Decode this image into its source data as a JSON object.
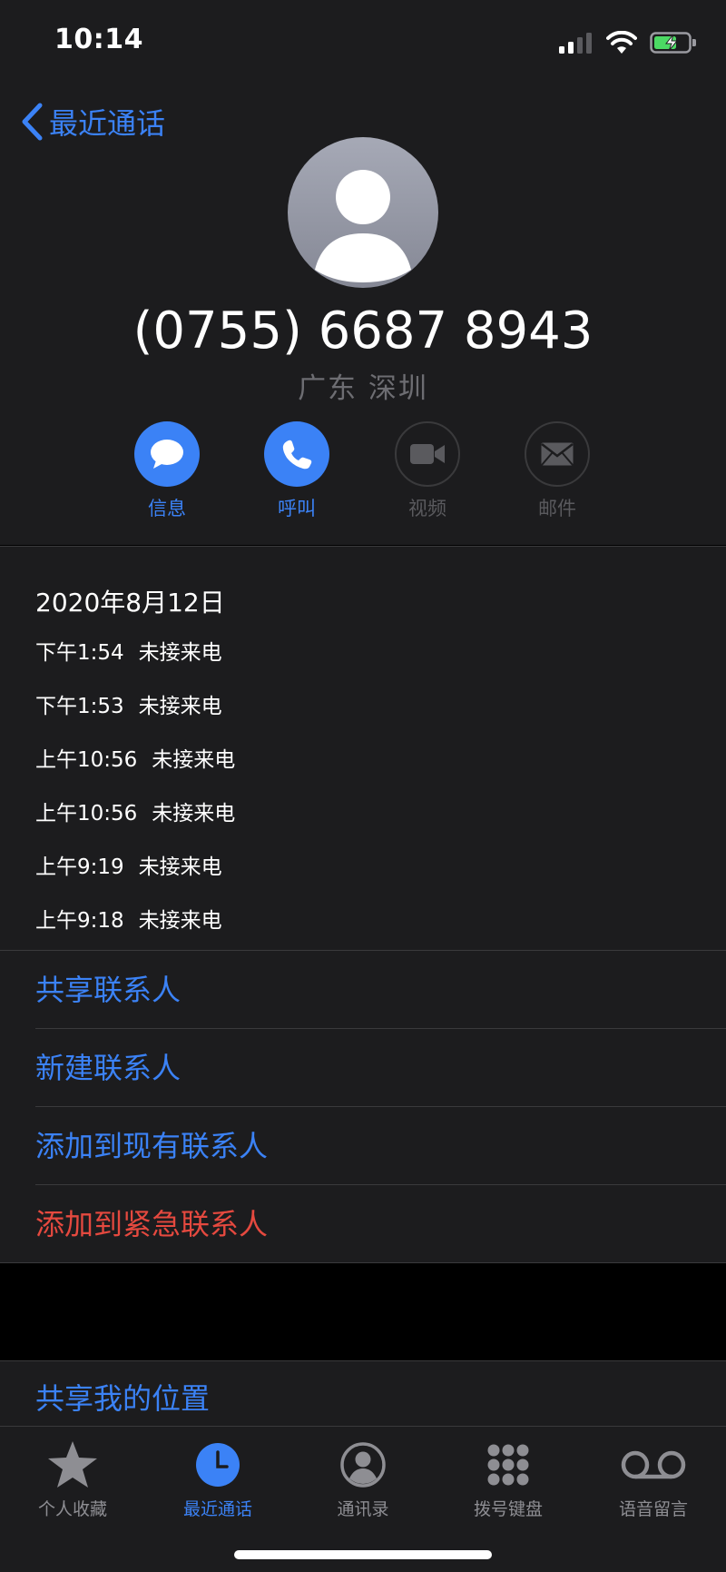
{
  "status_bar": {
    "time": "10:14"
  },
  "header": {
    "back_label": "最近通话",
    "phone_number": "(0755) 6687 8943",
    "location": "广东 深圳"
  },
  "actions": [
    {
      "label": "信息",
      "enabled": true
    },
    {
      "label": "呼叫",
      "enabled": true
    },
    {
      "label": "视频",
      "enabled": false
    },
    {
      "label": "邮件",
      "enabled": false
    }
  ],
  "history": {
    "date": "2020年8月12日",
    "calls": [
      {
        "time": "下午1:54",
        "status": "未接来电"
      },
      {
        "time": "下午1:53",
        "status": "未接来电"
      },
      {
        "time": "上午10:56",
        "status": "未接来电"
      },
      {
        "time": "上午10:56",
        "status": "未接来电"
      },
      {
        "time": "上午9:19",
        "status": "未接来电"
      },
      {
        "time": "上午9:18",
        "status": "未接来电"
      }
    ]
  },
  "contact_actions": [
    {
      "label": "共享联系人"
    },
    {
      "label": "新建联系人"
    },
    {
      "label": "添加到现有联系人"
    },
    {
      "label": "添加到紧急联系人"
    }
  ],
  "share_location": "共享我的位置",
  "tabs": [
    {
      "label": "个人收藏",
      "icon": "star-icon",
      "active": false
    },
    {
      "label": "最近通话",
      "icon": "clock-icon",
      "active": true
    },
    {
      "label": "通讯录",
      "icon": "contacts-icon",
      "active": false
    },
    {
      "label": "拨号键盘",
      "icon": "keypad-icon",
      "active": false
    },
    {
      "label": "语音留言",
      "icon": "voicemail-icon",
      "active": false
    }
  ],
  "colors": {
    "accent": "#3b82f6",
    "danger": "#e5493f",
    "background": "#1c1c1e",
    "battery": "#4cd964"
  }
}
